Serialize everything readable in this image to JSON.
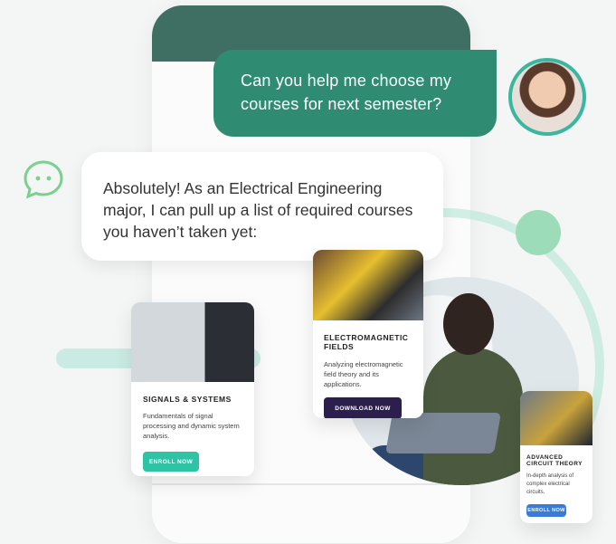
{
  "conversation": {
    "user_message": "Can you help me choose my courses for next semester?",
    "assistant_message": "Absolutely! As an Electrical Engineering major, I can pull up a list of required courses you haven’t taken yet:"
  },
  "courses": [
    {
      "title": "SIGNALS & SYSTEMS",
      "description": "Fundamentals of signal processing and dynamic system analysis.",
      "button_label": "ENROLL NOW"
    },
    {
      "title": "ELECTROMAGNETIC FIELDS",
      "description": "Analyzing electromagnetic field theory and its applications.",
      "button_label": "DOWNLOAD NOW"
    },
    {
      "title": "ADVANCED CIRCUIT THEORY",
      "description": "In-depth analysis of complex electrical circuits.",
      "button_label": "ENROLL NOW"
    }
  ],
  "colors": {
    "user_bubble": "#2f8c72",
    "avatar_ring": "#39b7a0",
    "enroll_button": "#2fc3a6",
    "download_button": "#2c1f4d",
    "enroll_button_blue": "#3a7bd5"
  }
}
